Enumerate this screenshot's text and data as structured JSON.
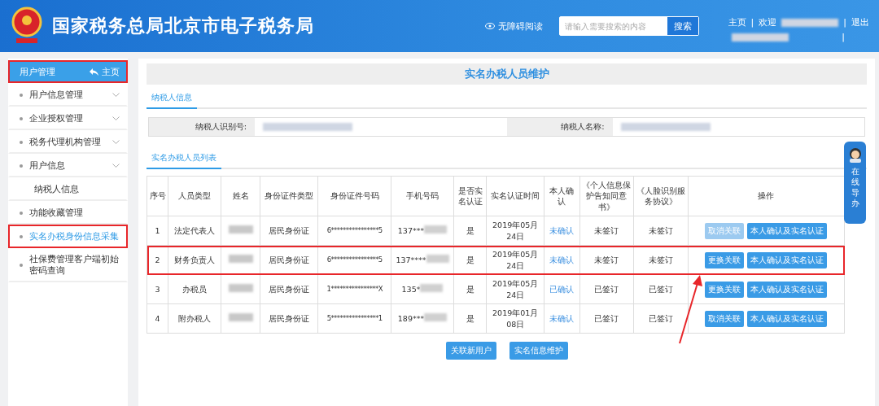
{
  "header": {
    "title": "国家税务总局北京市电子税务局",
    "accessibility": "无障碍阅读",
    "search": {
      "placeholder": "请输入需要搜索的内容",
      "button": "搜索"
    },
    "links": [
      {
        "kind": "link",
        "text": "主页"
      },
      {
        "kind": "sep",
        "text": "|"
      },
      {
        "kind": "link",
        "text": "欢迎"
      },
      {
        "kind": "redacted"
      },
      {
        "kind": "sep",
        "text": "|"
      },
      {
        "kind": "link",
        "text": "退出"
      }
    ],
    "trailing_sep": "|"
  },
  "sidebar": {
    "title": "用户管理",
    "home": "主页",
    "annotated": true,
    "items": [
      {
        "label": "用户信息管理",
        "bullet": true,
        "expandable": true,
        "selected": false,
        "annotated": false
      },
      {
        "label": "企业授权管理",
        "bullet": true,
        "expandable": true,
        "selected": false,
        "annotated": false
      },
      {
        "label": "税务代理机构管理",
        "bullet": true,
        "expandable": true,
        "selected": false,
        "annotated": false
      },
      {
        "label": "用户信息",
        "bullet": true,
        "expandable": true,
        "selected": false,
        "annotated": false
      },
      {
        "label": "纳税人信息",
        "bullet": false,
        "expandable": false,
        "selected": false,
        "annotated": false
      },
      {
        "label": "功能收藏管理",
        "bullet": true,
        "expandable": false,
        "selected": false,
        "annotated": false
      },
      {
        "label": "实名办税身份信息采集",
        "bullet": true,
        "expandable": false,
        "selected": true,
        "annotated": true
      },
      {
        "label": "社保费管理客户端初始密码查询",
        "bullet": true,
        "expandable": false,
        "selected": false,
        "annotated": false
      }
    ]
  },
  "main": {
    "title": "实名办税人员维护",
    "tabs": [
      {
        "label": "纳税人信息",
        "selected": true
      }
    ],
    "info": [
      {
        "label": "纳税人识别号:"
      },
      {
        "label": "纳税人名称:"
      }
    ],
    "list_tabs": [
      {
        "label": "实名办税人员列表",
        "selected": true
      }
    ],
    "table": {
      "columns": [
        "序号",
        "人员类型",
        "姓名",
        "身份证件类型",
        "身份证件号码",
        "手机号码",
        "是否实名认证",
        "实名认证时间",
        "本人确认",
        "《个人信息保护告知同意书》",
        "《人脸识别服务协议》",
        "操作"
      ],
      "rows": [
        {
          "no": "1",
          "type": "法定代表人",
          "id_type": "居民身份证",
          "id_no": "6****************5",
          "phone": "137***",
          "verified": "是",
          "time": "2019年05月24日",
          "confirm": "未确认",
          "consent": "未签订",
          "face": "未签订",
          "annotated": false,
          "actions": [
            {
              "label": "取消关联",
              "disabled": true
            },
            {
              "label": "本人确认及实名认证",
              "disabled": false
            }
          ]
        },
        {
          "no": "2",
          "type": "财务负责人",
          "id_type": "居民身份证",
          "id_no": "6****************5",
          "phone": "137****",
          "verified": "是",
          "time": "2019年05月24日",
          "confirm": "未确认",
          "consent": "未签订",
          "face": "未签订",
          "annotated": true,
          "actions": [
            {
              "label": "更换关联",
              "disabled": false
            },
            {
              "label": "本人确认及实名认证",
              "disabled": false
            }
          ]
        },
        {
          "no": "3",
          "type": "办税员",
          "id_type": "居民身份证",
          "id_no": "1****************X",
          "phone": "135*",
          "verified": "是",
          "time": "2019年05月24日",
          "confirm": "已确认",
          "consent": "已签订",
          "face": "已签订",
          "annotated": false,
          "actions": [
            {
              "label": "更换关联",
              "disabled": false
            },
            {
              "label": "本人确认及实名认证",
              "disabled": false
            }
          ]
        },
        {
          "no": "4",
          "type": "附办税人",
          "id_type": "居民身份证",
          "id_no": "5****************1",
          "phone": "189***",
          "verified": "是",
          "time": "2019年01月08日",
          "confirm": "未确认",
          "consent": "已签订",
          "face": "已签订",
          "annotated": false,
          "actions": [
            {
              "label": "取消关联",
              "disabled": false
            },
            {
              "label": "本人确认及实名认证",
              "disabled": false
            }
          ]
        }
      ]
    },
    "buttons": [
      "关联新用户",
      "实名信息维护"
    ]
  },
  "guide": {
    "label": "在线导办"
  }
}
